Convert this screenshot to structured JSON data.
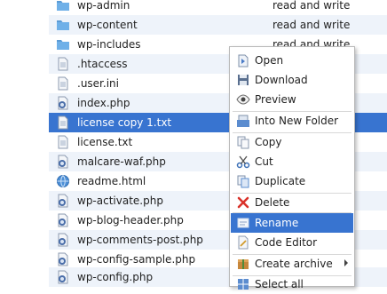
{
  "files": [
    {
      "name": "wp-admin",
      "perm": "read and write",
      "type": "folder"
    },
    {
      "name": "wp-content",
      "perm": "read and write",
      "type": "folder"
    },
    {
      "name": "wp-includes",
      "perm": "read and write",
      "type": "folder"
    },
    {
      "name": ".htaccess",
      "perm": "",
      "type": "file"
    },
    {
      "name": ".user.ini",
      "perm": "",
      "type": "file"
    },
    {
      "name": "index.php",
      "perm": "",
      "type": "php"
    },
    {
      "name": "license copy 1.txt",
      "perm": "",
      "type": "file"
    },
    {
      "name": "license.txt",
      "perm": "",
      "type": "file"
    },
    {
      "name": "malcare-waf.php",
      "perm": "",
      "type": "php"
    },
    {
      "name": "readme.html",
      "perm": "",
      "type": "html"
    },
    {
      "name": "wp-activate.php",
      "perm": "",
      "type": "php"
    },
    {
      "name": "wp-blog-header.php",
      "perm": "",
      "type": "php"
    },
    {
      "name": "wp-comments-post.php",
      "perm": "",
      "type": "php"
    },
    {
      "name": "wp-config-sample.php",
      "perm": "",
      "type": "php"
    },
    {
      "name": "wp-config.php",
      "perm": "",
      "type": "php"
    }
  ],
  "context_menu": {
    "open": "Open",
    "download": "Download",
    "preview": "Preview",
    "into_new_folder": "Into New Folder",
    "copy": "Copy",
    "cut": "Cut",
    "duplicate": "Duplicate",
    "delete": "Delete",
    "rename": "Rename",
    "code_editor": "Code Editor",
    "create_archive": "Create archive",
    "select_all": "Select all"
  },
  "colors": {
    "selection": "#3874d0",
    "row_alt": "#eef3fa",
    "folder": "#5b9bd5",
    "delete": "#d9322a"
  },
  "icons": {
    "folder": "folder-icon",
    "file": "file-icon",
    "php": "php-file-icon",
    "html": "globe-icon"
  }
}
